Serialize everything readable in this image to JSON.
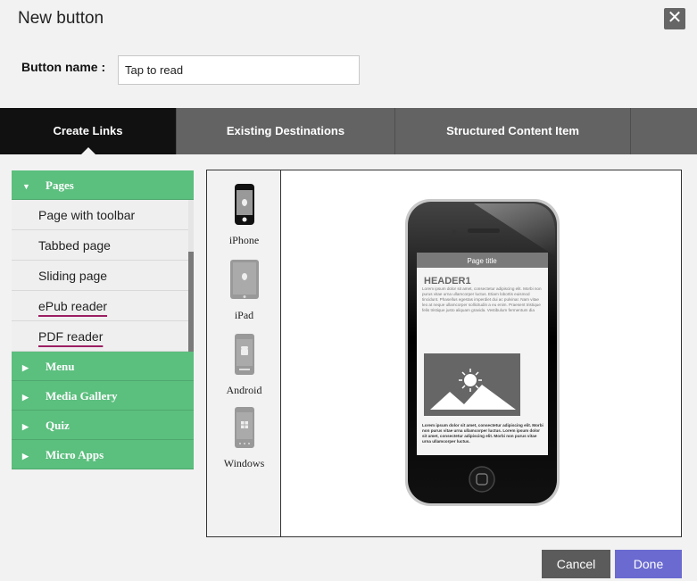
{
  "dialog": {
    "title": "New button",
    "close_icon": "close-icon"
  },
  "button_name": {
    "label": "Button name :",
    "value": "Tap to read"
  },
  "tabs": [
    {
      "label": "Create Links",
      "active": true
    },
    {
      "label": "Existing Destinations",
      "active": false
    },
    {
      "label": "Structured Content Item",
      "active": false
    }
  ],
  "sidebar": {
    "pages": {
      "label": "Pages",
      "items": [
        "Page with toolbar",
        "Tabbed page",
        "Sliding page",
        "ePub reader",
        "PDF reader"
      ]
    },
    "sections": [
      "Menu",
      "Media Gallery",
      "Quiz",
      "Micro Apps"
    ]
  },
  "devices": [
    "iPhone",
    "iPad",
    "Android",
    "Windows"
  ],
  "preview": {
    "page_title": "Page title",
    "header": "HEADER1",
    "body_text": "Lorem ipsum dolor sit amet, consectetur adipiscing elit. Morbi non purus vitae urna ullamcorper luctus. Etiam lobortis euismod tincidunt. Phasellus egestas imperdiet dui ac pulvinar. Nam vitae leo at neque ullamcorper sollicitudin a eu enim. Praesent tristique felis tristique justo aliquam gravida. Vestibulum fermentum dia",
    "bold_text": "Lorem ipsum dolor sit amet, consectetur adipiscing elit. Morbi non purus vitae urna ullamcorper luctus. Lorem ipsum dolor sit amet, consectetur adipiscing elit. Morbi non purus vitae urna ullamcorper luctus."
  },
  "actions": {
    "cancel": "Cancel",
    "done": "Done"
  },
  "colors": {
    "green": "#5bbf7e",
    "done": "#6a6ad1",
    "cancel": "#5b5b5b",
    "tab_active": "#111111",
    "tab_bar": "#636363"
  }
}
